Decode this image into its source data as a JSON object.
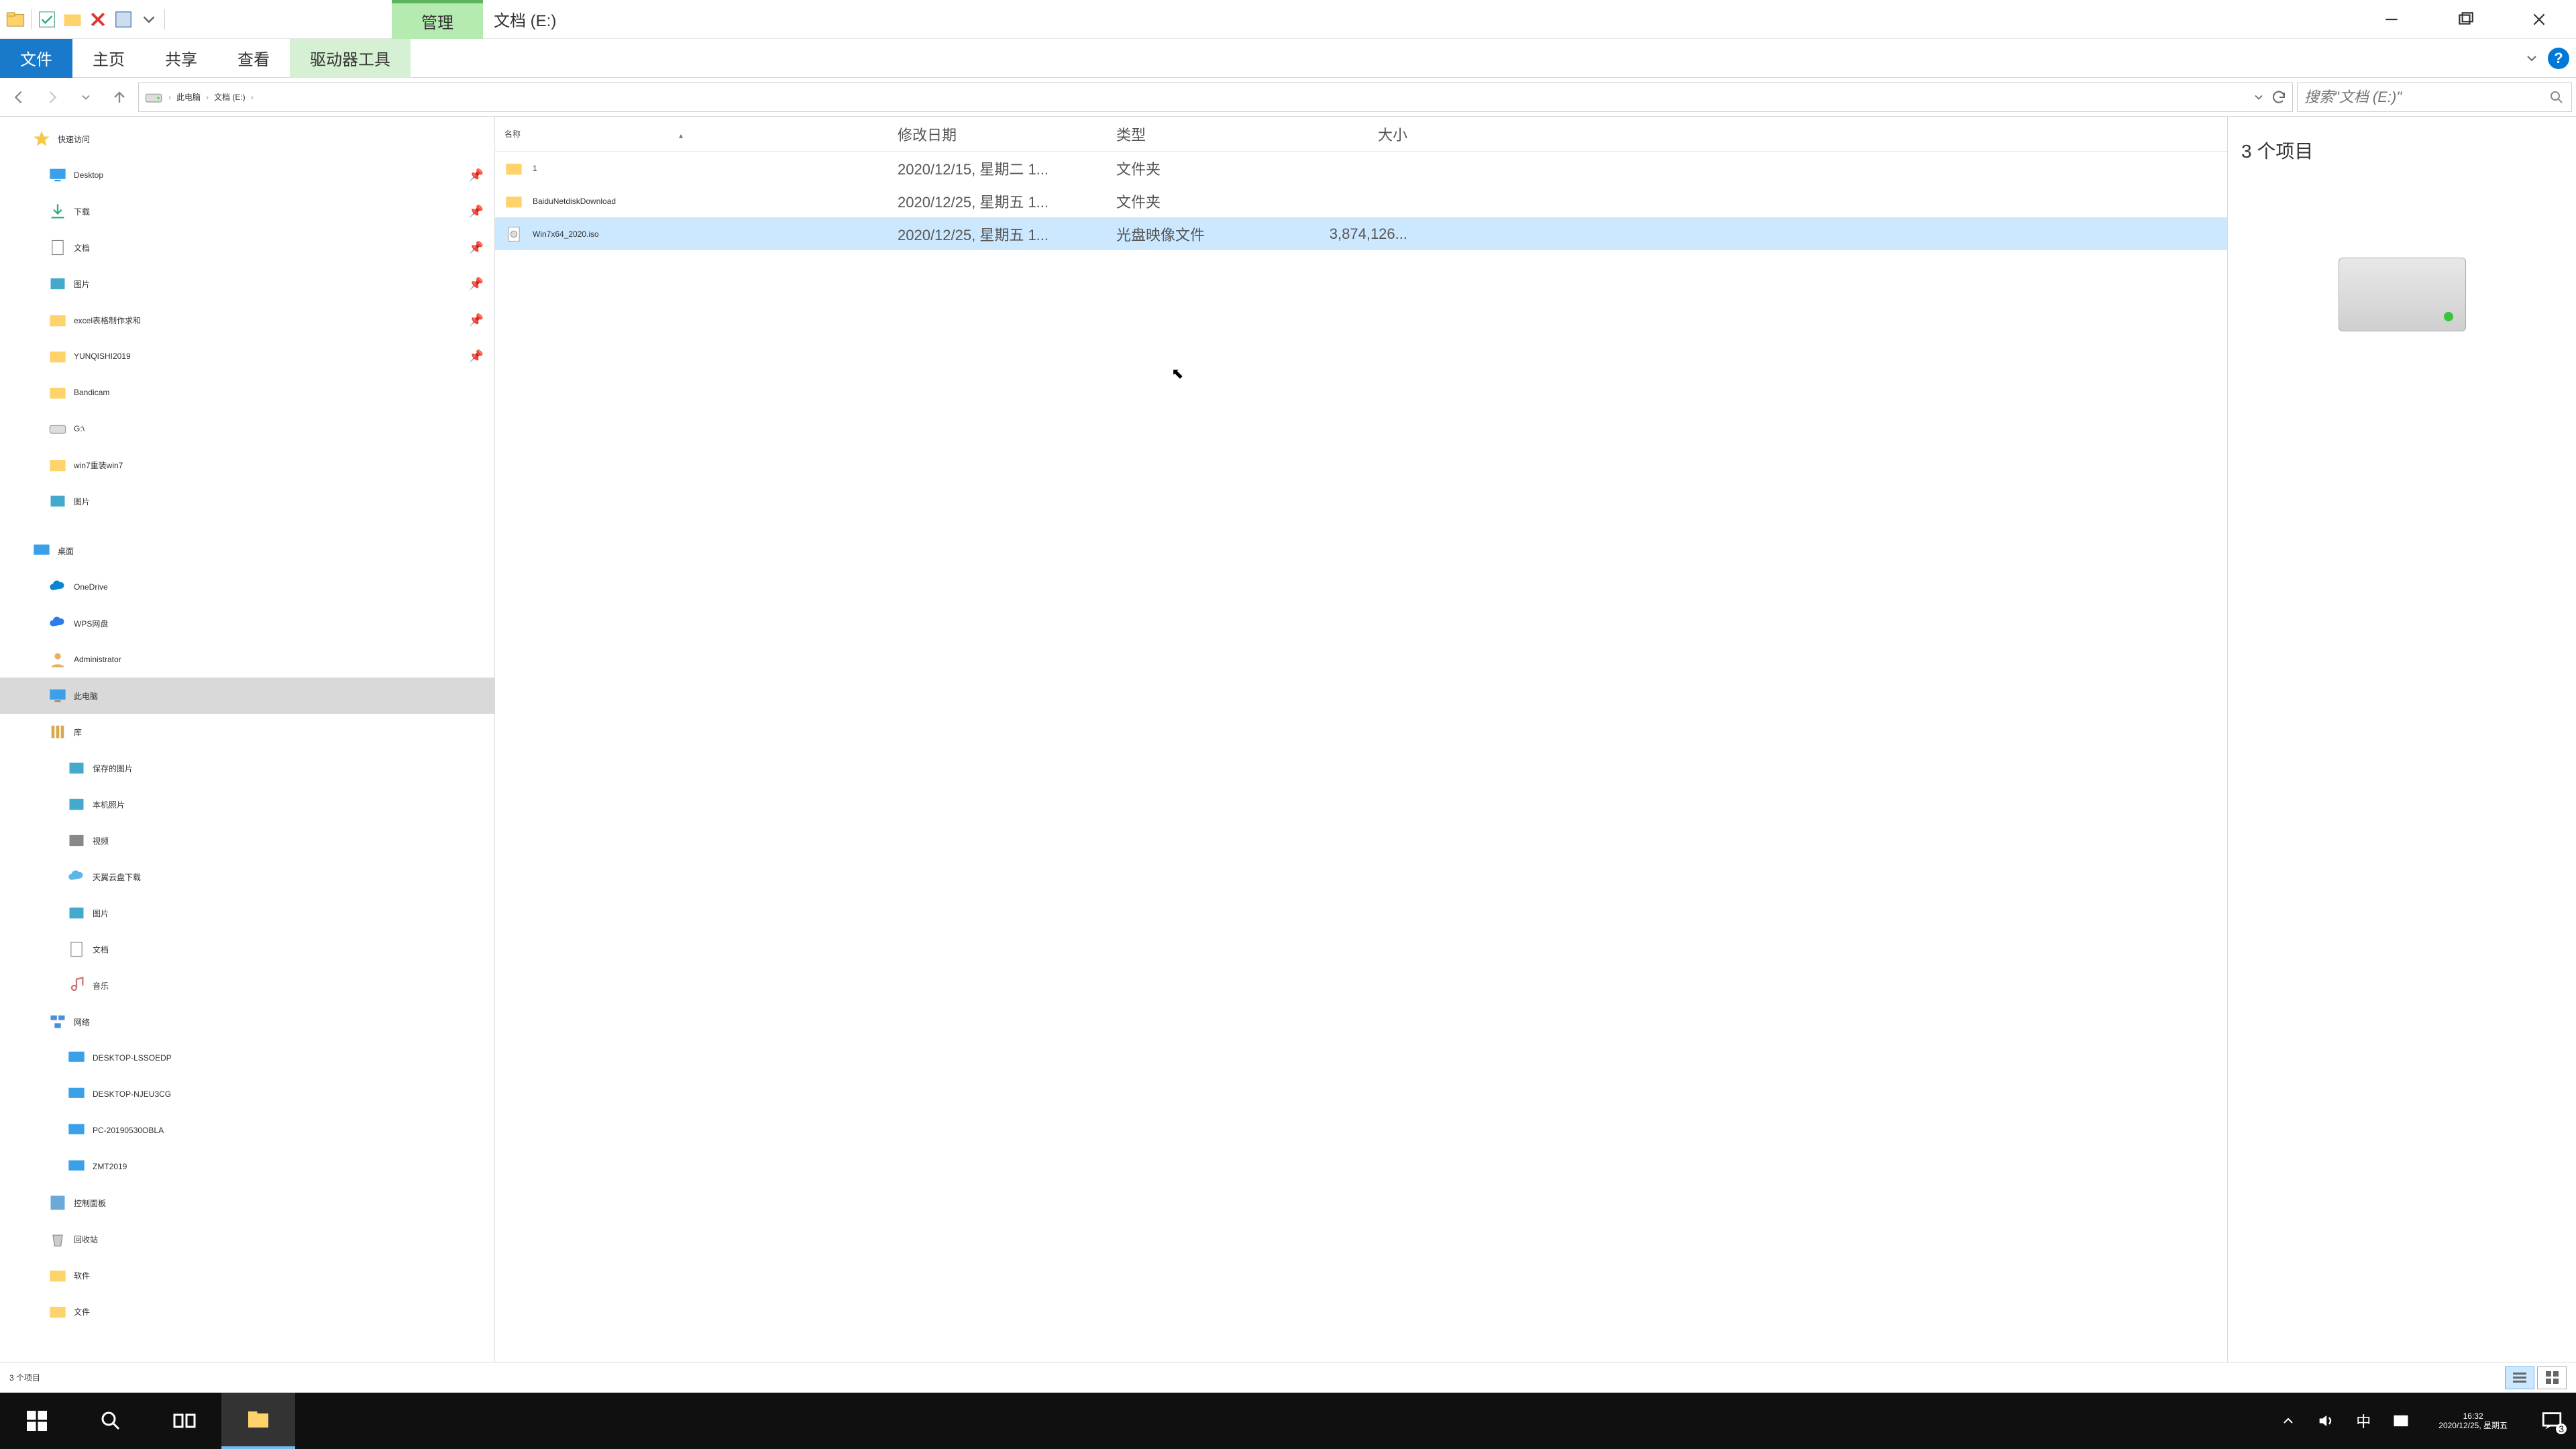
{
  "titlebar": {
    "context_tab": "管理",
    "drive_label": "文档 (E:)"
  },
  "ribbon": {
    "tabs": [
      "文件",
      "主页",
      "共享",
      "查看",
      "驱动器工具"
    ]
  },
  "address": {
    "crumbs": [
      "此电脑",
      "文档 (E:)"
    ]
  },
  "search": {
    "placeholder": "搜索\"文档 (E:)\""
  },
  "tree": {
    "quick_access": "快速访问",
    "quick_items": [
      {
        "label": "Desktop",
        "pin": true
      },
      {
        "label": "下载",
        "pin": true
      },
      {
        "label": "文档",
        "pin": true
      },
      {
        "label": "图片",
        "pin": true
      },
      {
        "label": "excel表格制作求和",
        "pin": true
      },
      {
        "label": "YUNQISHI2019",
        "pin": true
      },
      {
        "label": "Bandicam",
        "pin": false
      },
      {
        "label": "G:\\",
        "pin": false
      },
      {
        "label": "win7重装win7",
        "pin": false
      },
      {
        "label": "图片",
        "pin": false
      }
    ],
    "desktop": "桌面",
    "desktop_items": [
      "OneDrive",
      "WPS网盘",
      "Administrator",
      "此电脑",
      "库"
    ],
    "library_items": [
      "保存的图片",
      "本机照片",
      "视频",
      "天翼云盘下载",
      "图片",
      "文档",
      "音乐"
    ],
    "network": "网络",
    "network_items": [
      "DESKTOP-LSSOEDP",
      "DESKTOP-NJEU3CG",
      "PC-20190530OBLA",
      "ZMT2019"
    ],
    "extra": [
      "控制面板",
      "回收站",
      "软件",
      "文件"
    ]
  },
  "columns": {
    "name": "名称",
    "date": "修改日期",
    "type": "类型",
    "size": "大小"
  },
  "files": [
    {
      "name": "1",
      "date": "2020/12/15, 星期二 1...",
      "type": "文件夹",
      "size": "",
      "icon": "folder"
    },
    {
      "name": "BaiduNetdiskDownload",
      "date": "2020/12/25, 星期五 1...",
      "type": "文件夹",
      "size": "",
      "icon": "folder"
    },
    {
      "name": "Win7x64_2020.iso",
      "date": "2020/12/25, 星期五 1...",
      "type": "光盘映像文件",
      "size": "3,874,126...",
      "icon": "file",
      "selected": true
    }
  ],
  "preview": {
    "count": "3 个项目"
  },
  "status": {
    "text": "3 个项目"
  },
  "clock": {
    "time": "16:32",
    "date": "2020/12/25, 星期五"
  },
  "ime": "中",
  "notif_count": "3"
}
